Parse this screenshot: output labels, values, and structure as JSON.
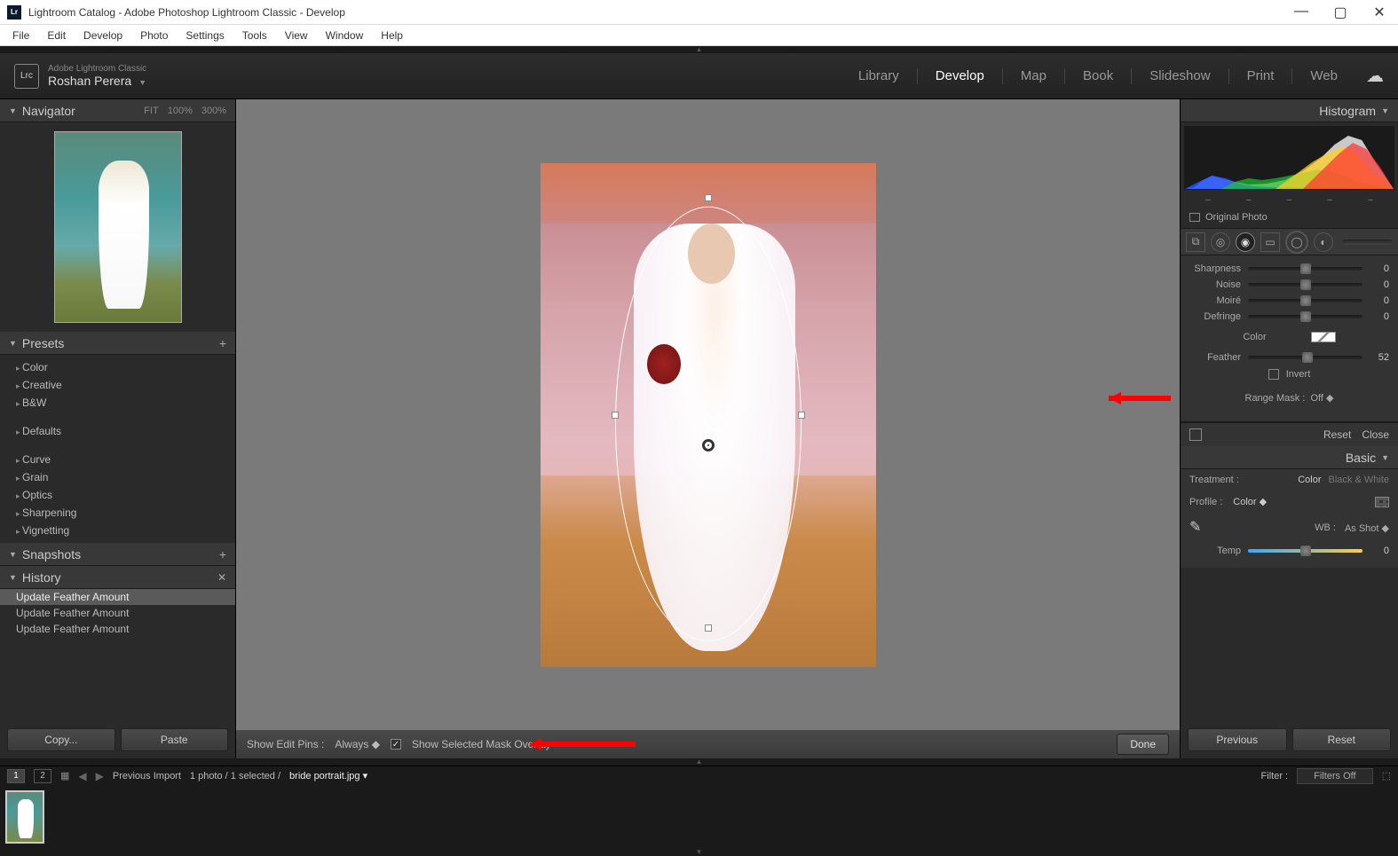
{
  "window": {
    "title": "Lightroom Catalog - Adobe Photoshop Lightroom Classic - Develop",
    "app_badge": "Lr"
  },
  "menu": [
    "File",
    "Edit",
    "Develop",
    "Photo",
    "Settings",
    "Tools",
    "View",
    "Window",
    "Help"
  ],
  "identity": {
    "product": "Adobe Lightroom Classic",
    "user": "Roshan Perera",
    "lrc": "Lrc"
  },
  "modules": [
    "Library",
    "Develop",
    "Map",
    "Book",
    "Slideshow",
    "Print",
    "Web"
  ],
  "active_module": "Develop",
  "navigator": {
    "title": "Navigator",
    "fit": "FIT",
    "z1": "100%",
    "z2": "300%"
  },
  "presets": {
    "title": "Presets",
    "groups1": [
      "Color",
      "Creative",
      "B&W"
    ],
    "groups2": [
      "Defaults"
    ],
    "groups3": [
      "Curve",
      "Grain",
      "Optics",
      "Sharpening",
      "Vignetting"
    ]
  },
  "snapshots": {
    "title": "Snapshots"
  },
  "history": {
    "title": "History",
    "items": [
      "Update Feather Amount",
      "Update Feather Amount",
      "Update Feather Amount"
    ]
  },
  "left_buttons": {
    "copy": "Copy...",
    "paste": "Paste"
  },
  "toolbar": {
    "show_pins_label": "Show Edit Pins :",
    "show_pins_value": "Always",
    "mask_overlay": "Show Selected Mask Overlay",
    "done": "Done"
  },
  "histogram": {
    "title": "Histogram",
    "original": "Original Photo"
  },
  "sliders": {
    "sharpness": {
      "label": "Sharpness",
      "value": "0",
      "pos": 50
    },
    "noise": {
      "label": "Noise",
      "value": "0",
      "pos": 50
    },
    "moire": {
      "label": "Moiré",
      "value": "0",
      "pos": 50
    },
    "defringe": {
      "label": "Defringe",
      "value": "0",
      "pos": 50
    },
    "feather": {
      "label": "Feather",
      "value": "52",
      "pos": 52
    },
    "temp": {
      "label": "Temp",
      "value": "0",
      "pos": 50
    }
  },
  "color_label": "Color",
  "invert": {
    "label": "Invert"
  },
  "range_mask": {
    "label": "Range Mask :",
    "value": "Off"
  },
  "reset_row": {
    "reset": "Reset",
    "close": "Close"
  },
  "basic": {
    "title": "Basic",
    "treatment": "Treatment :",
    "color": "Color",
    "bw": "Black & White",
    "profile": "Profile :",
    "profile_val": "Color",
    "wb": "WB :",
    "wb_val": "As Shot"
  },
  "right_buttons": {
    "previous": "Previous",
    "reset": "Reset"
  },
  "filmstrip": {
    "pages": [
      "1",
      "2"
    ],
    "source": "Previous Import",
    "count": "1 photo  / 1 selected  /",
    "filename": "bride portrait.jpg",
    "filter_label": "Filter :",
    "filter_value": "Filters Off"
  }
}
